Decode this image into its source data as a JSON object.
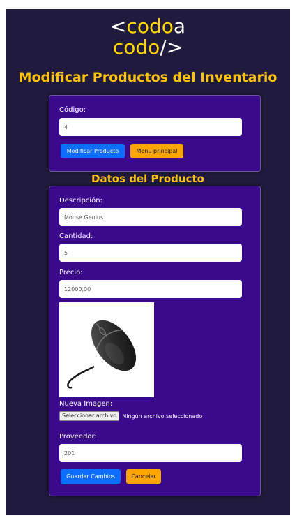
{
  "logo": {
    "line1_bracket": "<",
    "line1_word": "codo",
    "line1_suffix": "a",
    "line2_word": "codo",
    "line2_suffix": "/>"
  },
  "page_title": "Modificar Productos del Inventario",
  "search": {
    "code_label": "Código:",
    "code_value": "4",
    "modify_label": "Modificar Producto",
    "menu_label": "Menu principal"
  },
  "product_section_title": "Datos del Producto",
  "product": {
    "description_label": "Descripción:",
    "description_value": "Mouse Genius",
    "quantity_label": "Cantidad:",
    "quantity_value": "5",
    "price_label": "Precio:",
    "price_value": "12000,00",
    "new_image_label": "Nueva Imagen:",
    "file_button_label": "Seleccionar archivo",
    "file_status": "Ningún archivo seleccionado",
    "supplier_label": "Proveedor:",
    "supplier_value": "201",
    "save_label": "Guardar Cambios",
    "cancel_label": "Cancelar"
  },
  "colors": {
    "background": "#201a3c",
    "card": "#3b0a8c",
    "accent": "#ffc20e",
    "primary": "#0d6efd",
    "warning": "#ffa500"
  }
}
